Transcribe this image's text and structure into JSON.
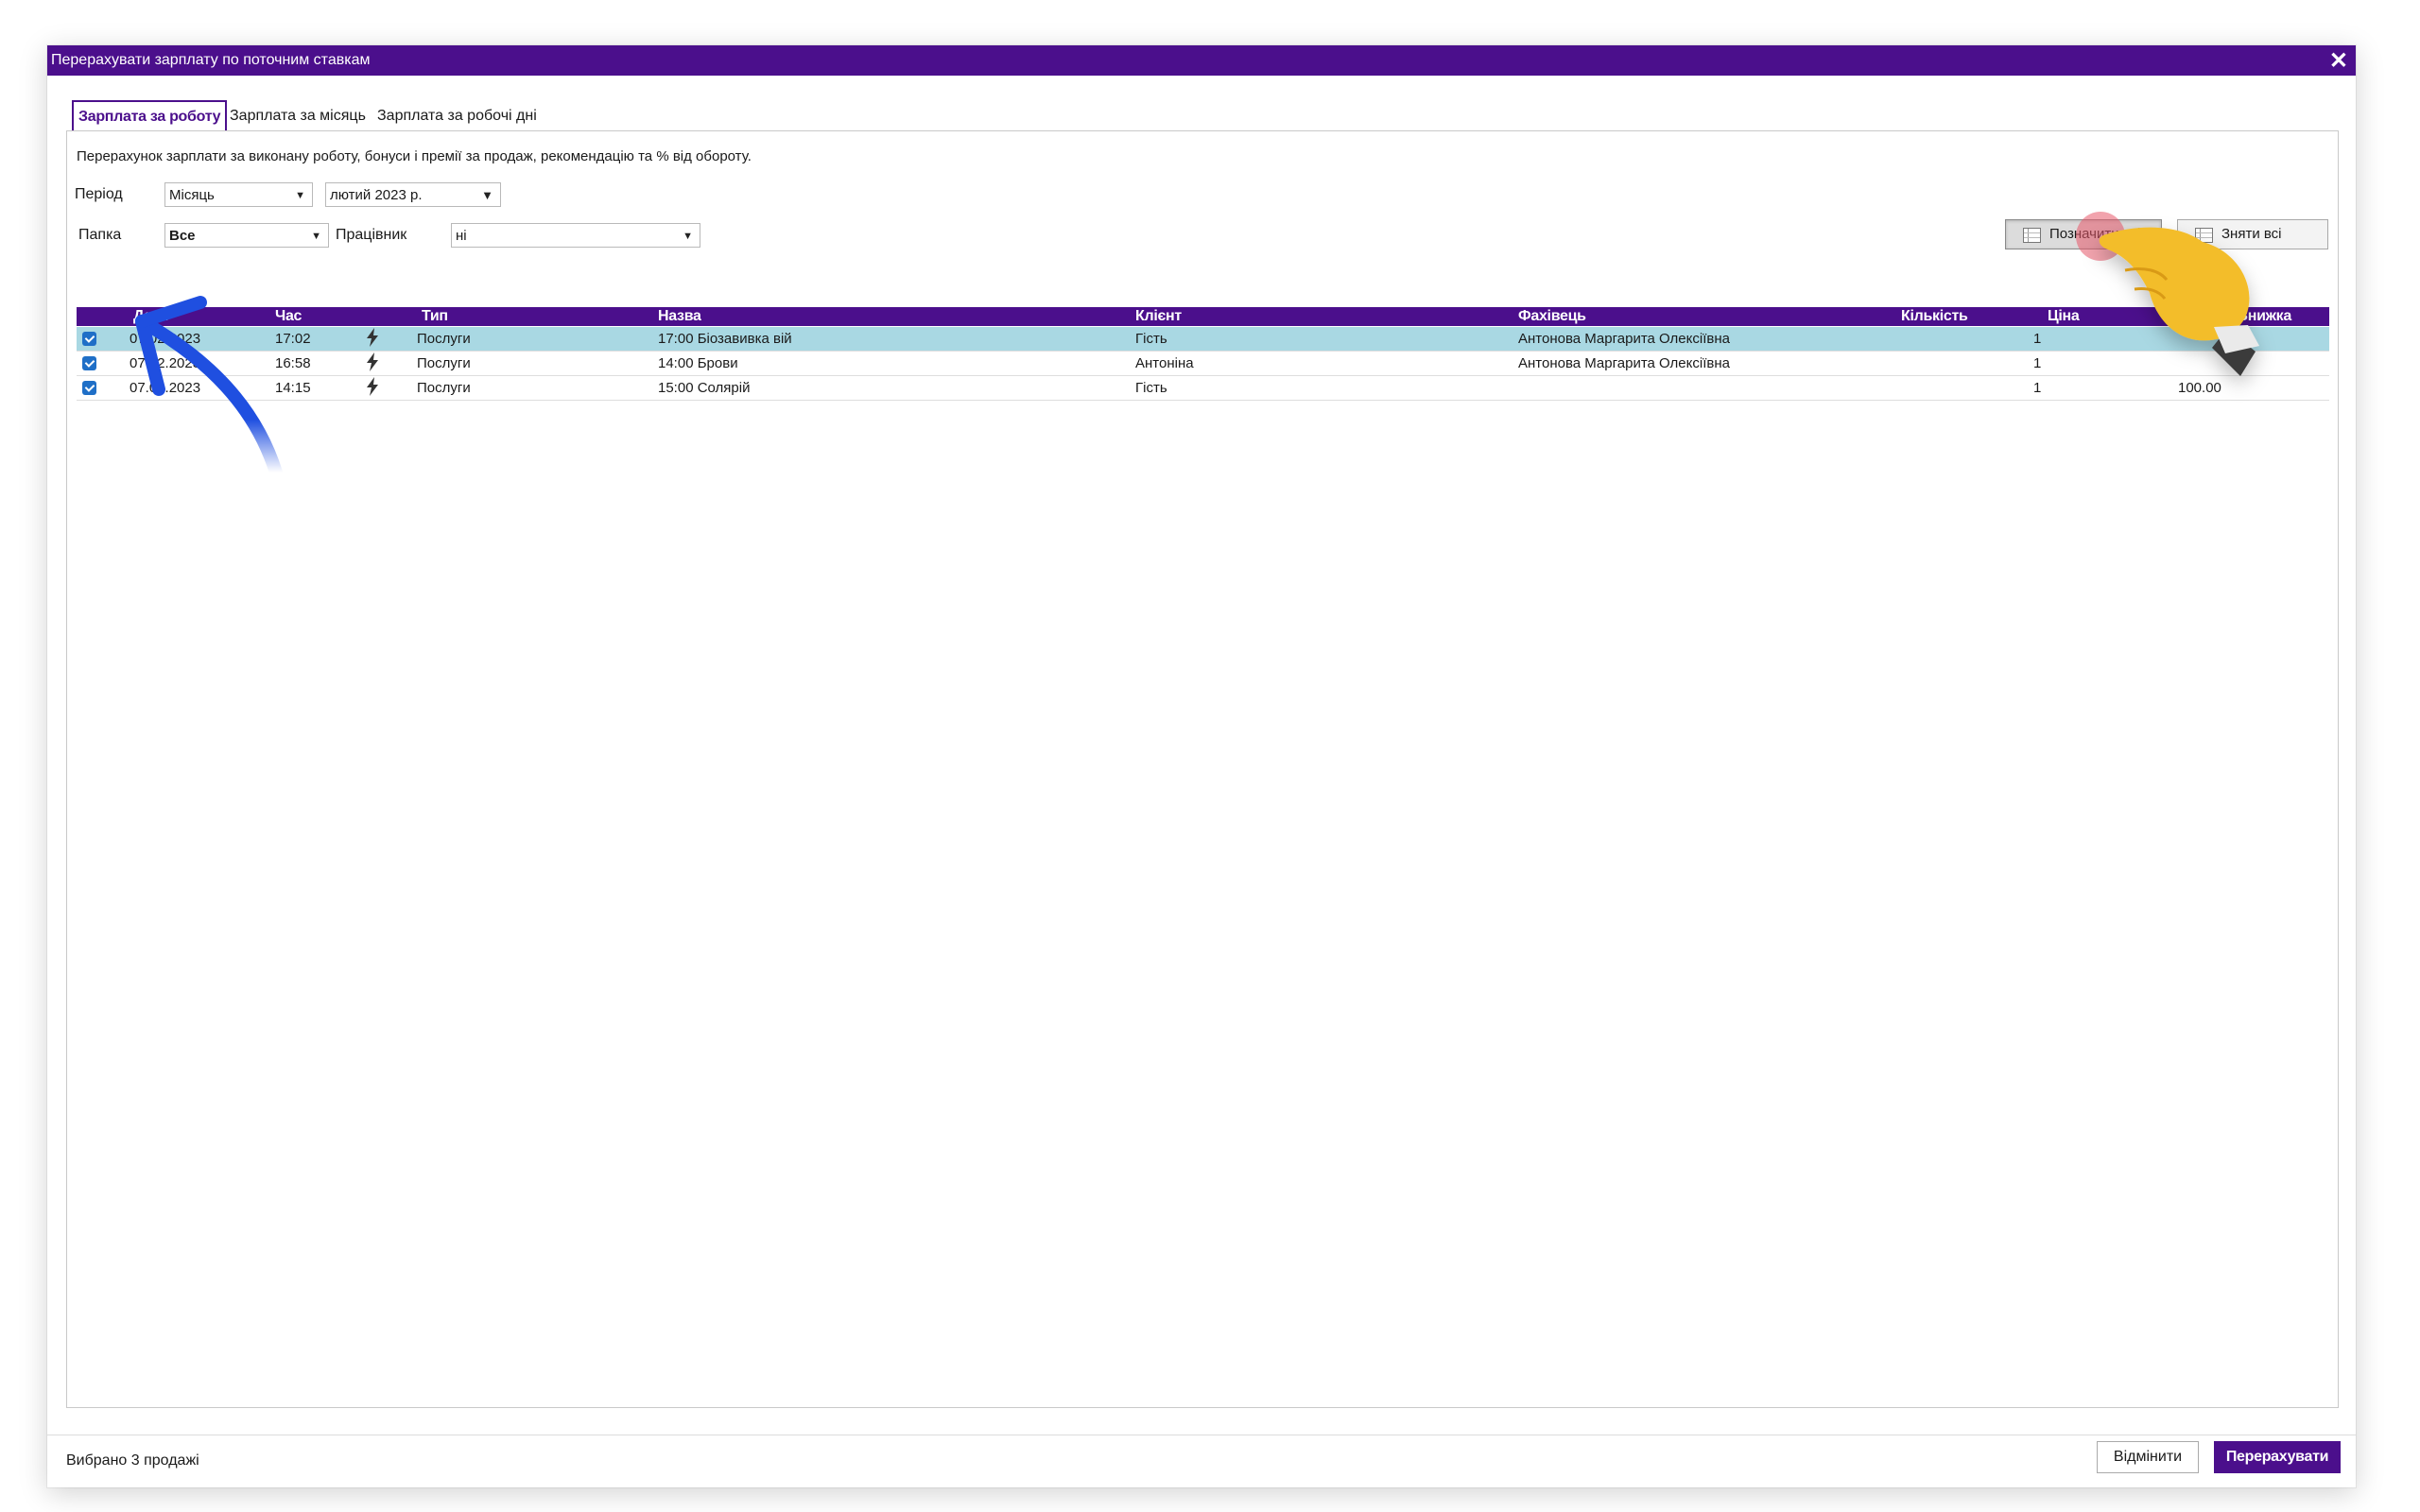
{
  "window": {
    "title": "Перерахувати зарплату по поточним ставкам",
    "accent_color": "#4b0f8c"
  },
  "tabs": [
    {
      "label": "Зарплата за роботу",
      "active": true
    },
    {
      "label": "Зарплата за місяць",
      "active": false
    },
    {
      "label": "Зарплата за робочі дні",
      "active": false
    }
  ],
  "description": "Перерахунок зарплати за виконану роботу, бонуси і премії за продаж, рекомендацію та % від обороту.",
  "filters": {
    "period_label": "Період",
    "period_type": "Місяць",
    "period_value": "лютий  2023 р.",
    "folder_label": "Папка",
    "folder_value": "Все",
    "employee_label": "Працівник",
    "employee_value": "ні"
  },
  "actions": {
    "select_all": "Позначити всі",
    "deselect_all": "Зняти всі"
  },
  "table": {
    "columns": [
      "Дата",
      "Час",
      "Тип",
      "Назва",
      "Клієнт",
      "Фахівець",
      "Кількість",
      "Ціна",
      "Знижка"
    ],
    "rows": [
      {
        "checked": true,
        "date": "07.02.2023",
        "time": "17:02",
        "type_icon": "lightning-icon",
        "type": "Послуги",
        "name": "17:00 Біозавивка вій",
        "client": "Гість",
        "specialist": "Антонова Маргарита Олексіївна",
        "qty": "1",
        "price": "",
        "selected": true
      },
      {
        "checked": true,
        "date": "07.02.2023",
        "time": "16:58",
        "type_icon": "lightning-icon",
        "type": "Послуги",
        "name": "14:00 Брови",
        "client": "Антоніна",
        "specialist": "Антонова Маргарита Олексіївна",
        "qty": "1",
        "price": "",
        "selected": false
      },
      {
        "checked": true,
        "date": "07.02.2023",
        "time": "14:15",
        "type_icon": "lightning-icon",
        "type": "Послуги",
        "name": "15:00 Солярій",
        "client": "Гість",
        "specialist": "",
        "qty": "1",
        "price": "100.00",
        "selected": false
      }
    ]
  },
  "footer": {
    "status": "Вибрано 3 продажі",
    "cancel": "Відмінити",
    "recalculate": "Перерахувати"
  },
  "annotations": {
    "arrow_color": "#1f4fe0",
    "hand_color": "#f3bd2b",
    "click_marker_color": "#e8576a"
  }
}
